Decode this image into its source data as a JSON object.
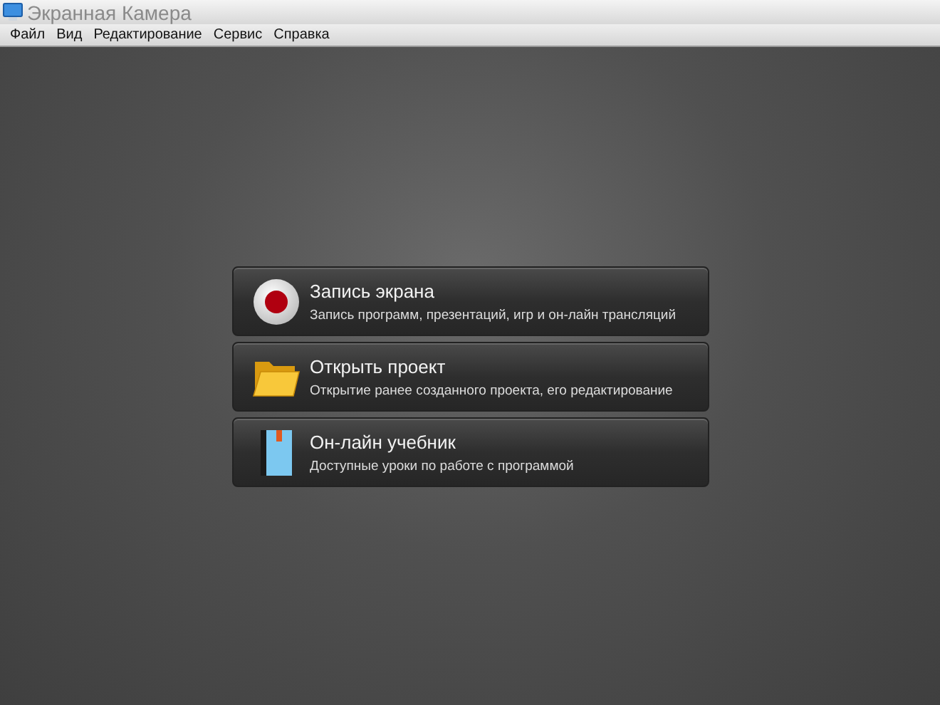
{
  "window": {
    "title": "Экранная Камера"
  },
  "menu": [
    "Файл",
    "Вид",
    "Редактирование",
    "Сервис",
    "Справка"
  ],
  "actions": [
    {
      "kind": "record",
      "title": "Запись экрана",
      "description": "Запись программ, презентаций, игр и он-лайн трансляций"
    },
    {
      "kind": "folder",
      "title": "Открыть проект",
      "description": "Открытие ранее созданного проекта, его редактирование"
    },
    {
      "kind": "book",
      "title": "Он-лайн учебник",
      "description": "Доступные уроки по работе с программой"
    }
  ]
}
